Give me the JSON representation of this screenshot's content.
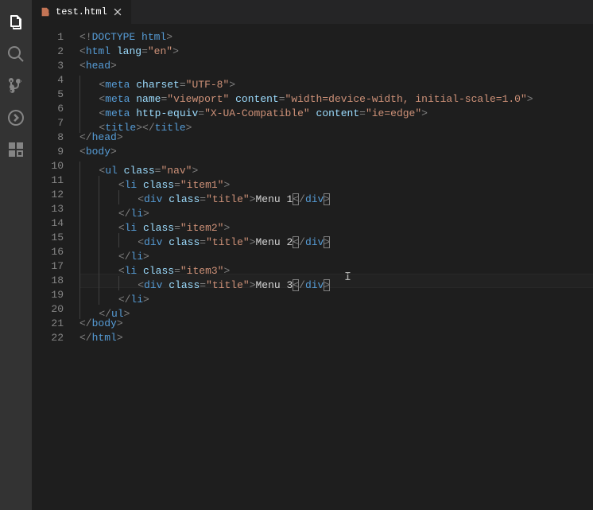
{
  "tabs": [
    {
      "name": "test.html"
    }
  ],
  "line_numbers": [
    "1",
    "2",
    "3",
    "4",
    "5",
    "6",
    "7",
    "8",
    "9",
    "10",
    "11",
    "12",
    "13",
    "14",
    "15",
    "16",
    "17",
    "18",
    "19",
    "20",
    "21",
    "22"
  ],
  "activity_bar": [
    "explorer",
    "search",
    "scm",
    "debug",
    "extensions"
  ],
  "cursor_glyph": "I",
  "code": [
    [
      [
        "b",
        "<!"
      ],
      [
        "d",
        "DOCTYPE"
      ],
      [
        "tx",
        " "
      ],
      [
        "d",
        "html"
      ],
      [
        "b",
        ">"
      ]
    ],
    [
      [
        "b",
        "<"
      ],
      [
        "t",
        "html"
      ],
      [
        "tx",
        " "
      ],
      [
        "a",
        "lang"
      ],
      [
        "b",
        "="
      ],
      [
        "s",
        "\"en\""
      ],
      [
        "b",
        ">"
      ]
    ],
    [
      [
        "b",
        "<"
      ],
      [
        "t",
        "head"
      ],
      [
        "b",
        ">"
      ]
    ],
    [
      [
        "tx",
        "    "
      ],
      [
        "b",
        "<"
      ],
      [
        "t",
        "meta"
      ],
      [
        "tx",
        " "
      ],
      [
        "a",
        "charset"
      ],
      [
        "b",
        "="
      ],
      [
        "s",
        "\"UTF-8\""
      ],
      [
        "b",
        ">"
      ]
    ],
    [
      [
        "tx",
        "    "
      ],
      [
        "b",
        "<"
      ],
      [
        "t",
        "meta"
      ],
      [
        "tx",
        " "
      ],
      [
        "a",
        "name"
      ],
      [
        "b",
        "="
      ],
      [
        "s",
        "\"viewport\""
      ],
      [
        "tx",
        " "
      ],
      [
        "a",
        "content"
      ],
      [
        "b",
        "="
      ],
      [
        "s",
        "\"width=device-width, initial-scale=1.0\""
      ],
      [
        "b",
        ">"
      ]
    ],
    [
      [
        "tx",
        "    "
      ],
      [
        "b",
        "<"
      ],
      [
        "t",
        "meta"
      ],
      [
        "tx",
        " "
      ],
      [
        "a",
        "http-equiv"
      ],
      [
        "b",
        "="
      ],
      [
        "s",
        "\"X-UA-Compatible\""
      ],
      [
        "tx",
        " "
      ],
      [
        "a",
        "content"
      ],
      [
        "b",
        "="
      ],
      [
        "s",
        "\"ie=edge\""
      ],
      [
        "b",
        ">"
      ]
    ],
    [
      [
        "tx",
        "    "
      ],
      [
        "b",
        "<"
      ],
      [
        "t",
        "title"
      ],
      [
        "b",
        ">"
      ],
      [
        "b",
        "</"
      ],
      [
        "t",
        "title"
      ],
      [
        "b",
        ">"
      ]
    ],
    [
      [
        "b",
        "</"
      ],
      [
        "t",
        "head"
      ],
      [
        "b",
        ">"
      ]
    ],
    [
      [
        "b",
        "<"
      ],
      [
        "t",
        "body"
      ],
      [
        "b",
        ">"
      ]
    ],
    [
      [
        "tx",
        "    "
      ],
      [
        "b",
        "<"
      ],
      [
        "t",
        "ul"
      ],
      [
        "tx",
        " "
      ],
      [
        "a",
        "class"
      ],
      [
        "b",
        "="
      ],
      [
        "s",
        "\"nav\""
      ],
      [
        "b",
        ">"
      ]
    ],
    [
      [
        "tx",
        "        "
      ],
      [
        "b",
        "<"
      ],
      [
        "t",
        "li"
      ],
      [
        "tx",
        " "
      ],
      [
        "a",
        "class"
      ],
      [
        "b",
        "="
      ],
      [
        "s",
        "\"item1\""
      ],
      [
        "b",
        ">"
      ]
    ],
    [
      [
        "tx",
        "            "
      ],
      [
        "b",
        "<"
      ],
      [
        "t",
        "div"
      ],
      [
        "tx",
        " "
      ],
      [
        "a",
        "class"
      ],
      [
        "b",
        "="
      ],
      [
        "s",
        "\"title\""
      ],
      [
        "b",
        ">"
      ],
      [
        "tx",
        "Menu 1"
      ],
      [
        "bx",
        "<"
      ],
      [
        "b",
        "/"
      ],
      [
        "t",
        "div"
      ],
      [
        "bx",
        ">"
      ]
    ],
    [
      [
        "tx",
        "        "
      ],
      [
        "b",
        "</"
      ],
      [
        "t",
        "li"
      ],
      [
        "b",
        ">"
      ]
    ],
    [
      [
        "tx",
        "        "
      ],
      [
        "b",
        "<"
      ],
      [
        "t",
        "li"
      ],
      [
        "tx",
        " "
      ],
      [
        "a",
        "class"
      ],
      [
        "b",
        "="
      ],
      [
        "s",
        "\"item2\""
      ],
      [
        "b",
        ">"
      ]
    ],
    [
      [
        "tx",
        "            "
      ],
      [
        "b",
        "<"
      ],
      [
        "t",
        "div"
      ],
      [
        "tx",
        " "
      ],
      [
        "a",
        "class"
      ],
      [
        "b",
        "="
      ],
      [
        "s",
        "\"title\""
      ],
      [
        "b",
        ">"
      ],
      [
        "tx",
        "Menu 2"
      ],
      [
        "bx",
        "<"
      ],
      [
        "b",
        "/"
      ],
      [
        "t",
        "div"
      ],
      [
        "bx",
        ">"
      ]
    ],
    [
      [
        "tx",
        "        "
      ],
      [
        "b",
        "</"
      ],
      [
        "t",
        "li"
      ],
      [
        "b",
        ">"
      ]
    ],
    [
      [
        "tx",
        "        "
      ],
      [
        "b",
        "<"
      ],
      [
        "t",
        "li"
      ],
      [
        "tx",
        " "
      ],
      [
        "a",
        "class"
      ],
      [
        "b",
        "="
      ],
      [
        "s",
        "\"item3\""
      ],
      [
        "b",
        ">"
      ]
    ],
    [
      [
        "tx",
        "            "
      ],
      [
        "b",
        "<"
      ],
      [
        "t",
        "div"
      ],
      [
        "tx",
        " "
      ],
      [
        "a",
        "class"
      ],
      [
        "b",
        "="
      ],
      [
        "s",
        "\"title\""
      ],
      [
        "b",
        ">"
      ],
      [
        "tx",
        "Menu 3"
      ],
      [
        "bx",
        "<"
      ],
      [
        "b",
        "/"
      ],
      [
        "t",
        "div"
      ],
      [
        "bx",
        ">"
      ]
    ],
    [
      [
        "tx",
        "        "
      ],
      [
        "b",
        "</"
      ],
      [
        "t",
        "li"
      ],
      [
        "b",
        ">"
      ]
    ],
    [
      [
        "tx",
        "    "
      ],
      [
        "b",
        "</"
      ],
      [
        "t",
        "ul"
      ],
      [
        "b",
        ">"
      ]
    ],
    [
      [
        "b",
        "</"
      ],
      [
        "t",
        "body"
      ],
      [
        "b",
        ">"
      ]
    ],
    [
      [
        "b",
        "</"
      ],
      [
        "t",
        "html"
      ],
      [
        "b",
        ">"
      ]
    ]
  ]
}
